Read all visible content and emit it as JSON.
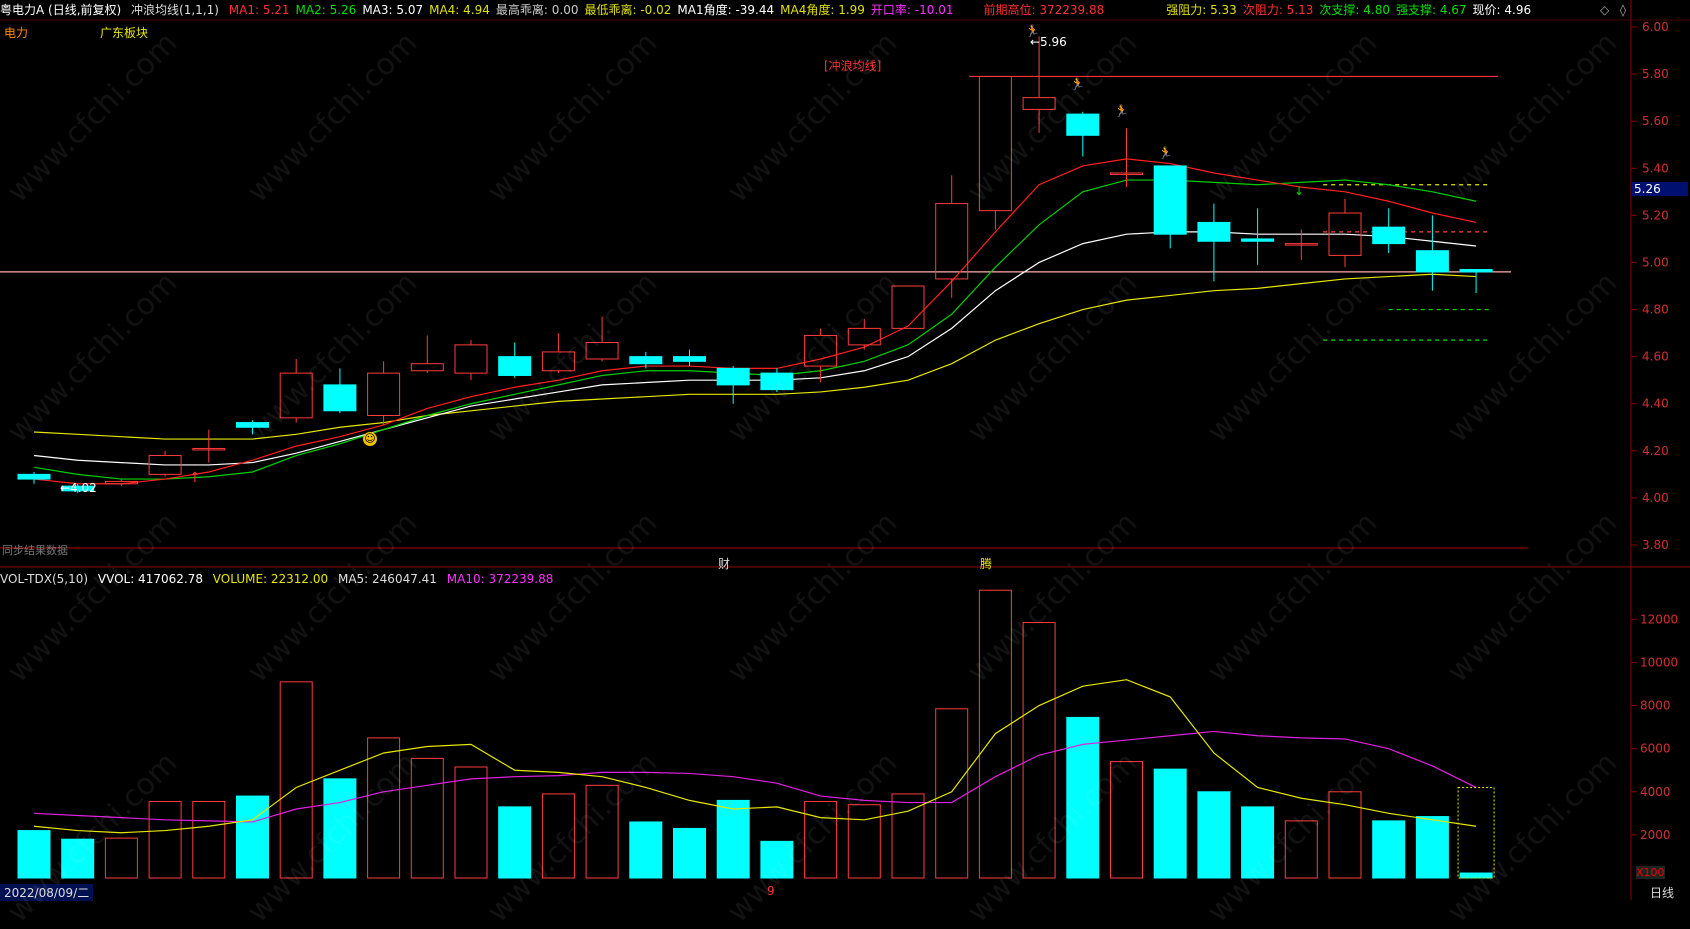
{
  "header": {
    "stock": "粤电力A (日线,前复权)",
    "indicator": "冲浪均线(1,1,1)",
    "items": [
      {
        "label": "MA1: 5.21",
        "color": "#ff3030"
      },
      {
        "label": "MA2: 5.26",
        "color": "#00e000"
      },
      {
        "label": "MA3: 5.07",
        "color": "#ffffff"
      },
      {
        "label": "MA4: 4.94",
        "color": "#e0e000"
      },
      {
        "label": "最高乖离: 0.00",
        "color": "#cccccc"
      },
      {
        "label": "最低乖离: -0.02",
        "color": "#e0e000"
      },
      {
        "label": "MA1角度: -39.44",
        "color": "#ffffff"
      },
      {
        "label": "MA4角度: 1.99",
        "color": "#e0e000"
      },
      {
        "label": "开口率: -10.01",
        "color": "#ff30ff"
      },
      {
        "label": "前期高位: 372239.88",
        "color": "#ff3030"
      },
      {
        "label": "强阻力: 5.33",
        "color": "#e0e000"
      },
      {
        "label": "次阻力: 5.13",
        "color": "#ff3030"
      },
      {
        "label": "次支撑: 4.80",
        "color": "#00e000"
      },
      {
        "label": "强支撑: 4.67",
        "color": "#00e000"
      },
      {
        "label": "现价: 4.96",
        "color": "#ffffff"
      }
    ]
  },
  "tags": {
    "sector1": "电力",
    "sector2": "广东板块",
    "chart_label": "[冲浪均线]",
    "finance": "财",
    "surge": "腾",
    "no_data": "同步结果数据",
    "low_label": "←4.02",
    "high_label": "←5.96",
    "current_price": "5.26",
    "x100": "X100",
    "date": "2022/08/09/二",
    "period": "日线",
    "cursor_mark": "9"
  },
  "volume_header": {
    "name": "VOL-TDX(5,10)",
    "vvol": "VVOL: 417062.78",
    "volume": "VOLUME: 22312.00",
    "ma5": "MA5: 246047.41",
    "ma10": "MA10: 372239.88"
  },
  "colors": {
    "up": "#ff3b3b",
    "down": "#00ffff",
    "ma1": "#ff2020",
    "ma2": "#00d000",
    "ma3": "#ffffff",
    "ma4": "#e6e600",
    "ma5v": "#e6e600",
    "ma10v": "#e020e0"
  },
  "chart_data": {
    "type": "candlestick",
    "price_axis": {
      "min": 3.8,
      "max": 6.0,
      "ticks": [
        "6.00",
        "5.80",
        "5.60",
        "5.40",
        "5.20",
        "5.00",
        "4.80",
        "4.60",
        "4.40",
        "4.20",
        "4.00",
        "3.80"
      ]
    },
    "volume_axis": {
      "min": 0,
      "max": 13500,
      "ticks": [
        "12000",
        "10000",
        "8000",
        "6000",
        "4000",
        "2000"
      ]
    },
    "candles": [
      {
        "o": 4.1,
        "c": 4.08,
        "h": 4.11,
        "l": 4.06
      },
      {
        "o": 4.05,
        "c": 4.03,
        "h": 4.06,
        "l": 4.02
      },
      {
        "o": 4.06,
        "c": 4.07,
        "h": 4.08,
        "l": 4.05
      },
      {
        "o": 4.1,
        "c": 4.18,
        "h": 4.2,
        "l": 4.09
      },
      {
        "o": 4.21,
        "c": 4.21,
        "h": 4.29,
        "l": 4.15
      },
      {
        "o": 4.32,
        "c": 4.3,
        "h": 4.33,
        "l": 4.27
      },
      {
        "o": 4.34,
        "c": 4.53,
        "h": 4.59,
        "l": 4.32
      },
      {
        "o": 4.48,
        "c": 4.37,
        "h": 4.55,
        "l": 4.36
      },
      {
        "o": 4.35,
        "c": 4.53,
        "h": 4.58,
        "l": 4.31
      },
      {
        "o": 4.54,
        "c": 4.57,
        "h": 4.69,
        "l": 4.53
      },
      {
        "o": 4.53,
        "c": 4.65,
        "h": 4.67,
        "l": 4.5
      },
      {
        "o": 4.6,
        "c": 4.52,
        "h": 4.66,
        "l": 4.51
      },
      {
        "o": 4.54,
        "c": 4.62,
        "h": 4.7,
        "l": 4.53
      },
      {
        "o": 4.59,
        "c": 4.66,
        "h": 4.77,
        "l": 4.58
      },
      {
        "o": 4.6,
        "c": 4.57,
        "h": 4.62,
        "l": 4.55
      },
      {
        "o": 4.6,
        "c": 4.58,
        "h": 4.63,
        "l": 4.56
      },
      {
        "o": 4.55,
        "c": 4.48,
        "h": 4.56,
        "l": 4.4
      },
      {
        "o": 4.53,
        "c": 4.46,
        "h": 4.55,
        "l": 4.45
      },
      {
        "o": 4.56,
        "c": 4.69,
        "h": 4.72,
        "l": 4.49
      },
      {
        "o": 4.65,
        "c": 4.72,
        "h": 4.76,
        "l": 4.63
      },
      {
        "o": 4.72,
        "c": 4.9,
        "h": 4.9,
        "l": 4.72
      },
      {
        "o": 4.93,
        "c": 5.25,
        "h": 5.37,
        "l": 4.85
      },
      {
        "o": 5.22,
        "c": 5.79,
        "h": 5.79,
        "l": 5.14
      },
      {
        "o": 5.65,
        "c": 5.7,
        "h": 5.96,
        "l": 5.55
      },
      {
        "o": 5.63,
        "c": 5.54,
        "h": 5.64,
        "l": 5.45
      },
      {
        "o": 5.38,
        "c": 5.38,
        "h": 5.57,
        "l": 5.32
      },
      {
        "o": 5.41,
        "c": 5.12,
        "h": 5.41,
        "l": 5.06
      },
      {
        "o": 5.17,
        "c": 5.09,
        "h": 5.25,
        "l": 4.92
      },
      {
        "o": 5.1,
        "c": 5.09,
        "h": 5.23,
        "l": 4.99
      },
      {
        "o": 5.08,
        "c": 5.08,
        "h": 5.14,
        "l": 5.01
      },
      {
        "o": 5.03,
        "c": 5.21,
        "h": 5.27,
        "l": 4.98
      },
      {
        "o": 5.15,
        "c": 5.08,
        "h": 5.23,
        "l": 5.04
      },
      {
        "o": 5.05,
        "c": 4.96,
        "h": 5.2,
        "l": 4.88
      },
      {
        "o": 4.97,
        "c": 4.96,
        "h": 4.97,
        "l": 4.87
      }
    ],
    "ma1": [
      4.08,
      4.06,
      4.06,
      4.08,
      4.11,
      4.16,
      4.22,
      4.26,
      4.31,
      4.38,
      4.43,
      4.47,
      4.5,
      4.54,
      4.56,
      4.56,
      4.55,
      4.55,
      4.59,
      4.64,
      4.73,
      4.92,
      5.13,
      5.33,
      5.41,
      5.44,
      5.42,
      5.38,
      5.35,
      5.32,
      5.3,
      5.26,
      5.21,
      5.17
    ],
    "ma2": [
      4.13,
      4.1,
      4.08,
      4.08,
      4.09,
      4.11,
      4.18,
      4.23,
      4.29,
      4.35,
      4.4,
      4.44,
      4.48,
      4.52,
      4.54,
      4.54,
      4.53,
      4.52,
      4.54,
      4.58,
      4.65,
      4.78,
      4.98,
      5.16,
      5.3,
      5.35,
      5.35,
      5.34,
      5.33,
      5.34,
      5.35,
      5.33,
      5.3,
      5.26
    ],
    "ma3": [
      4.18,
      4.16,
      4.15,
      4.14,
      4.14,
      4.15,
      4.19,
      4.24,
      4.29,
      4.34,
      4.39,
      4.42,
      4.45,
      4.48,
      4.49,
      4.5,
      4.5,
      4.5,
      4.51,
      4.54,
      4.6,
      4.72,
      4.88,
      5.0,
      5.08,
      5.12,
      5.13,
      5.13,
      5.12,
      5.12,
      5.12,
      5.11,
      5.09,
      5.07
    ],
    "ma4": [
      4.28,
      4.27,
      4.26,
      4.25,
      4.25,
      4.25,
      4.27,
      4.3,
      4.32,
      4.35,
      4.37,
      4.39,
      4.41,
      4.42,
      4.43,
      4.44,
      4.44,
      4.44,
      4.45,
      4.47,
      4.5,
      4.57,
      4.67,
      4.74,
      4.8,
      4.84,
      4.86,
      4.88,
      4.89,
      4.91,
      4.93,
      4.94,
      4.95,
      4.94
    ],
    "volumes": [
      2200,
      1800,
      1850,
      3550,
      3550,
      3800,
      9100,
      4600,
      6500,
      5550,
      5150,
      3300,
      3900,
      4300,
      2600,
      2300,
      3600,
      1700,
      3550,
      3400,
      3900,
      7850,
      13350,
      11850,
      7450,
      5400,
      5050,
      4000,
      3300,
      2650,
      4000,
      2650,
      2850,
      230
    ],
    "vol_ma5": [
      2400,
      2200,
      2100,
      2200,
      2400,
      2700,
      4200,
      5000,
      5800,
      6100,
      6200,
      5000,
      4900,
      4700,
      4200,
      3600,
      3200,
      3300,
      2800,
      2700,
      3100,
      4000,
      6700,
      8000,
      8900,
      9200,
      8400,
      5800,
      4200,
      3700,
      3400,
      3000,
      2700,
      2400
    ],
    "vol_ma10": [
      3000,
      2900,
      2800,
      2700,
      2650,
      2600,
      3200,
      3500,
      4000,
      4300,
      4600,
      4700,
      4750,
      4900,
      4900,
      4850,
      4700,
      4400,
      3800,
      3600,
      3500,
      3500,
      4700,
      5700,
      6200,
      6400,
      6600,
      6800,
      6600,
      6500,
      6450,
      6000,
      5200,
      4200
    ],
    "hlines": [
      {
        "name": "prev-high",
        "value": 5.79,
        "color": "#ff3030",
        "dash": "",
        "from": 21.4,
        "to": 33.5
      },
      {
        "name": "strong-resist",
        "value": 5.33,
        "color": "#e6e600",
        "dash": "4,4",
        "from": 29.5,
        "to": 33.3
      },
      {
        "name": "sub-resist",
        "value": 5.13,
        "color": "#ff4040",
        "dash": "4,4",
        "from": 29.5,
        "to": 33.3
      },
      {
        "name": "sub-support",
        "value": 4.8,
        "color": "#00e000",
        "dash": "4,4",
        "from": 31.0,
        "to": 33.3
      },
      {
        "name": "strong-support",
        "value": 4.67,
        "color": "#00e000",
        "dash": "4,4",
        "from": 29.5,
        "to": 33.3
      },
      {
        "name": "cur-price",
        "value": 4.96,
        "color": "#ffb0b0",
        "dash": "",
        "from": -1,
        "to": 33.8
      }
    ]
  }
}
